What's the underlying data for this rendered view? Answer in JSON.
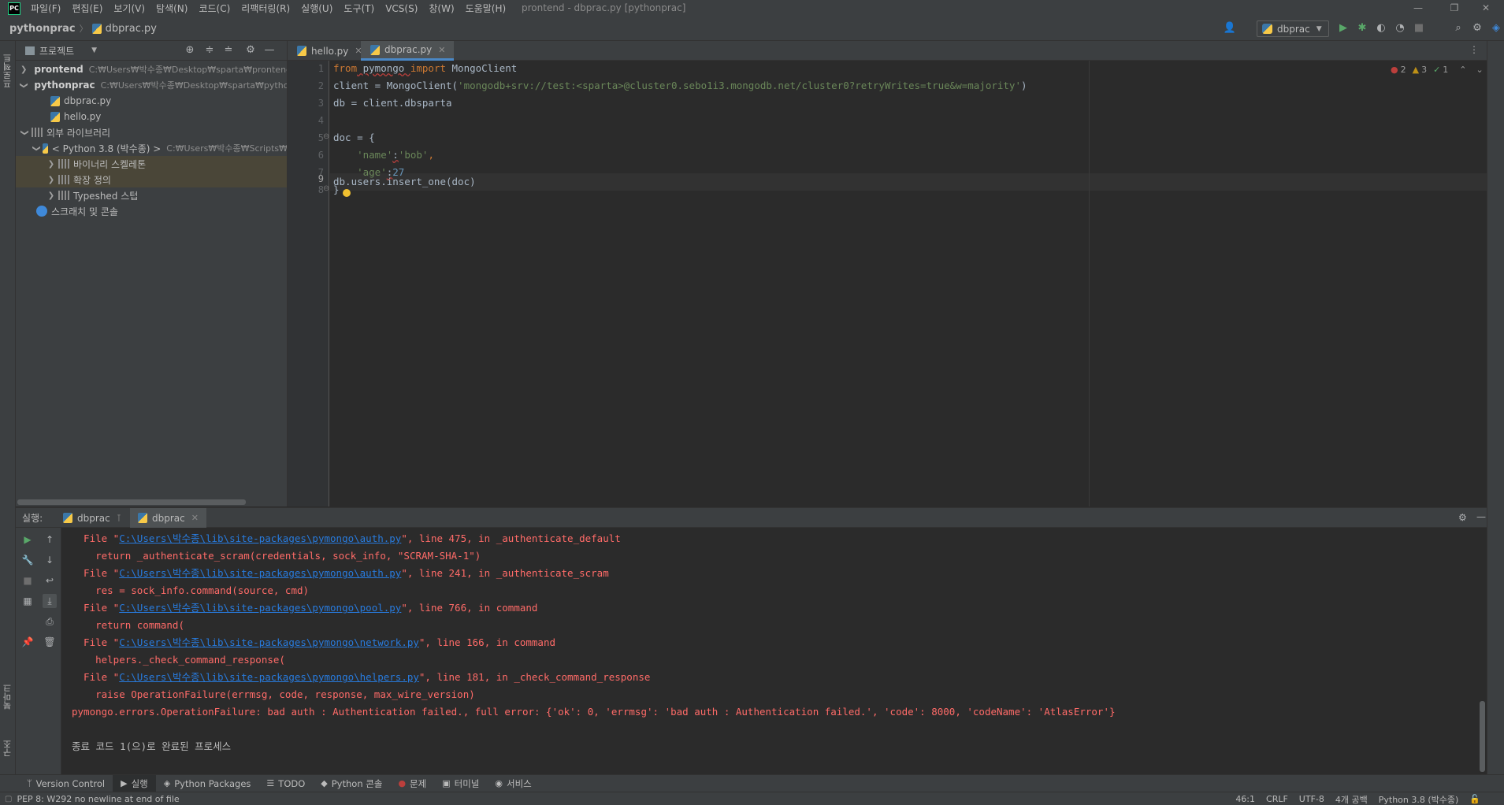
{
  "menubar": {
    "logo": "PC",
    "items": [
      "파일(F)",
      "편집(E)",
      "보기(V)",
      "탐색(N)",
      "코드(C)",
      "리팩터링(R)",
      "실행(U)",
      "도구(T)",
      "VCS(S)",
      "창(W)",
      "도움말(H)"
    ],
    "window_title": "prontend - dbprac.py [pythonprac]"
  },
  "navbar": {
    "breadcrumb": [
      "pythonprac",
      "dbprac.py"
    ],
    "run_config": "dbprac"
  },
  "project_panel": {
    "title": "프로젝트",
    "tree": [
      {
        "name": "prontend",
        "path": "C:₩Users₩박수종₩Desktop₩sparta₩prontend"
      },
      {
        "name": "pythonprac",
        "path": "C:₩Users₩박수종₩Desktop₩sparta₩pythonprac"
      },
      {
        "name": "dbprac.py"
      },
      {
        "name": "hello.py"
      },
      {
        "name": "외부 라이브러리"
      },
      {
        "name": "< Python 3.8 (박수종) >",
        "path": "C:₩Users₩박수종₩Scripts₩"
      },
      {
        "name": "바이너리 스켈레톤"
      },
      {
        "name": "확장 정의"
      },
      {
        "name": "Typeshed 스텁"
      },
      {
        "name": "스크래치 및 콘솔"
      }
    ]
  },
  "editor_tabs": [
    {
      "label": "hello.py"
    },
    {
      "label": "dbprac.py"
    }
  ],
  "editor": {
    "line_numbers": [
      "1",
      "2",
      "3",
      "4",
      "5",
      "6",
      "7",
      "8",
      "9"
    ],
    "inspection": {
      "errors": "2",
      "warnings": "3",
      "weak": "1"
    },
    "code": {
      "l1_kw1": "from",
      "l1_mod": " pymongo ",
      "l1_kw2": "import",
      "l1_name": " MongoClient",
      "l2_a": "client = MongoClient(",
      "l2_str": "'mongodb+srv://test:<sparta>@cluster0.sebo1i3.mongodb.net/cluster0?retryWrites=true&w=majority'",
      "l2_b": ")",
      "l3": "db = client.dbsparta",
      "l5": "doc = {",
      "l6_str1": "'name'",
      "l6_colon": ":",
      "l6_str2": "'bob'",
      "l6_comma": ",",
      "l7_str": "'age'",
      "l7_colon": ":",
      "l7_num": "27",
      "l8": "}",
      "l9": "db.users.insert_one(doc)"
    }
  },
  "run_panel": {
    "label": "실행:",
    "tabs": [
      {
        "label": "dbprac"
      },
      {
        "label": "dbprac"
      }
    ],
    "console": [
      {
        "pre": "  File \"",
        "link": "C:\\Users\\박수종\\lib\\site-packages\\pymongo\\auth.py",
        "post": "\", line 475, in _authenticate_default"
      },
      {
        "text": "    return _authenticate_scram(credentials, sock_info, \"SCRAM-SHA-1\")"
      },
      {
        "pre": "  File \"",
        "link": "C:\\Users\\박수종\\lib\\site-packages\\pymongo\\auth.py",
        "post": "\", line 241, in _authenticate_scram"
      },
      {
        "text": "    res = sock_info.command(source, cmd)"
      },
      {
        "pre": "  File \"",
        "link": "C:\\Users\\박수종\\lib\\site-packages\\pymongo\\pool.py",
        "post": "\", line 766, in command"
      },
      {
        "text": "    return command("
      },
      {
        "pre": "  File \"",
        "link": "C:\\Users\\박수종\\lib\\site-packages\\pymongo\\network.py",
        "post": "\", line 166, in command"
      },
      {
        "text": "    helpers._check_command_response("
      },
      {
        "pre": "  File \"",
        "link": "C:\\Users\\박수종\\lib\\site-packages\\pymongo\\helpers.py",
        "post": "\", line 181, in _check_command_response"
      },
      {
        "text": "    raise OperationFailure(errmsg, code, response, max_wire_version)"
      },
      {
        "text": "pymongo.errors.OperationFailure: bad auth : Authentication failed., full error: {'ok': 0, 'errmsg': 'bad auth : Authentication failed.', 'code': 8000, 'codeName': 'AtlasError'}"
      },
      {
        "text": "종료 코드 1(으)로 완료된 프로세스"
      }
    ]
  },
  "left_strip": {
    "project": "프로젝트",
    "bookmarks": "북마크",
    "structure": "구조"
  },
  "bottom_bar": {
    "tabs": [
      "Version Control",
      "실행",
      "Python Packages",
      "TODO",
      "Python 콘솔",
      "문제",
      "터미널",
      "서비스"
    ]
  },
  "status_bar": {
    "message": "PEP 8: W292 no newline at end of file",
    "position": "46:1",
    "line_sep": "CRLF",
    "encoding": "UTF-8",
    "indent": "4개 공백",
    "interpreter": "Python 3.8 (박수종)"
  }
}
